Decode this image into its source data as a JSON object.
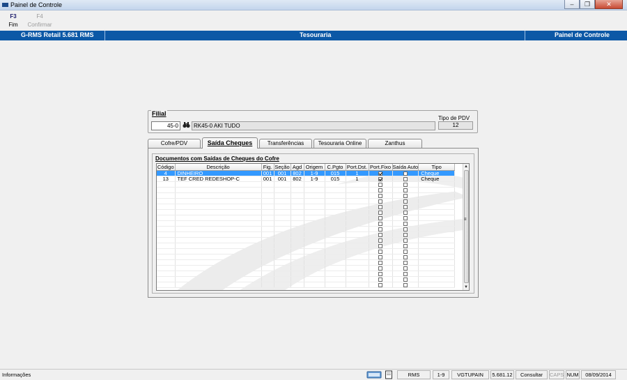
{
  "window": {
    "title": "Painel de Controle"
  },
  "toolbar": {
    "items": [
      {
        "key": "F3",
        "label": "Fim",
        "enabled": true
      },
      {
        "key": "F4",
        "label": "Confirmar",
        "enabled": false
      }
    ]
  },
  "header": {
    "left": "G-RMS Retail 5.681 RMS",
    "center": "Tesouraria",
    "right": "Painel de Controle"
  },
  "filial": {
    "legend": "Filial",
    "code": "45-0",
    "name": "RK45-0 AKI TUDO",
    "pdv_label": "Tipo de PDV",
    "pdv_value": "12"
  },
  "tabs": [
    "Cofre/PDV",
    "Saída Cheques",
    "Transferências",
    "Tesouraria Online",
    "Zanthus"
  ],
  "active_tab": "Saída Cheques",
  "group": {
    "title": "Documentos com Saídas de Cheques do Cofre"
  },
  "table": {
    "columns": [
      "Código",
      "Descrição",
      "Fig.",
      "Seção",
      "Agd",
      "Origem",
      "C.Pgto",
      "Port.Dst.",
      "Port.Fixo",
      "Saída Auto",
      "Tipo"
    ],
    "rows": [
      {
        "codigo": "4",
        "descricao": "DINHEIRO",
        "fig": "001",
        "secao": "001",
        "agd": "802",
        "origem": "1-9",
        "cpgto": "015",
        "portdst": "1",
        "portfixo": true,
        "saidaauto": false,
        "tipo": "Cheque",
        "selected": true
      },
      {
        "codigo": "13",
        "descricao": "TEF CRED REDESHOP-C",
        "fig": "001",
        "secao": "001",
        "agd": "802",
        "origem": "1-9",
        "cpgto": "015",
        "portdst": "1",
        "portfixo": true,
        "saidaauto": false,
        "tipo": "Cheque",
        "selected": false
      }
    ],
    "empty_rows": 19
  },
  "status": {
    "info": "Informações",
    "cells": [
      {
        "text": "RMS",
        "dim": false
      },
      {
        "text": "1-9",
        "dim": false
      },
      {
        "text": "VGTUPAIN",
        "dim": false
      },
      {
        "text": "5.681.12",
        "dim": false
      },
      {
        "text": "Consultar",
        "dim": false
      },
      {
        "text": "CAPS",
        "dim": true
      },
      {
        "text": "NUM",
        "dim": false
      },
      {
        "text": "08/09/2014",
        "dim": false
      }
    ]
  },
  "colors": {
    "header_bar": "#0c58a6",
    "selection": "#3399ff"
  }
}
